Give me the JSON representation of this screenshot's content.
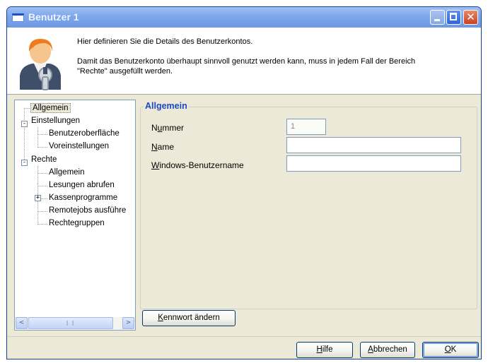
{
  "window": {
    "title": "Benutzer 1"
  },
  "header": {
    "line1": "Hier definieren Sie die Details des Benutzerkontos.",
    "line2": "Damit das Benutzerkonto überhaupt sinnvoll genutzt werden kann, muss in jedem Fall der Bereich",
    "line3": "\"Rechte\" ausgefüllt werden."
  },
  "tree": {
    "items": [
      {
        "label": "Allgemein",
        "level": 0,
        "selected": true
      },
      {
        "label": "Einstellungen",
        "level": 0,
        "expander": "-"
      },
      {
        "label": "Benutzeroberfläche",
        "level": 1
      },
      {
        "label": "Voreinstellungen",
        "level": 1
      },
      {
        "label": "Rechte",
        "level": 0,
        "expander": "-"
      },
      {
        "label": "Allgemein",
        "level": 1
      },
      {
        "label": "Lesungen abrufen",
        "level": 1
      },
      {
        "label": "Kassenprogramme",
        "level": 1,
        "expander": "+"
      },
      {
        "label": "Remotejobs ausführe",
        "level": 1
      },
      {
        "label": "Rechtegruppen",
        "level": 1
      }
    ]
  },
  "group": {
    "title": "Allgemein"
  },
  "form": {
    "number_label_pre": "N",
    "number_label_ul": "u",
    "number_label_post": "mmer",
    "number_value": "1",
    "name_label_ul": "N",
    "name_label_post": "ame",
    "name_value": "",
    "winuser_label_ul": "W",
    "winuser_label_post": "indows-Benutzername",
    "winuser_value": ""
  },
  "buttons": {
    "password_ul": "K",
    "password_rest": "ennwort ändern",
    "help_ul": "H",
    "help_rest": "ilfe",
    "cancel_ul": "A",
    "cancel_rest": "bbrechen",
    "ok_ul": "O",
    "ok_rest": "K"
  },
  "scrollbar": {
    "left_arrow": "<",
    "right_arrow": ">"
  },
  "titlebar_buttons": {
    "close_glyph": "✕"
  },
  "colors": {
    "accent": "#1c49c0",
    "titlebar": "#7ea7ea",
    "close": "#c9411f"
  }
}
